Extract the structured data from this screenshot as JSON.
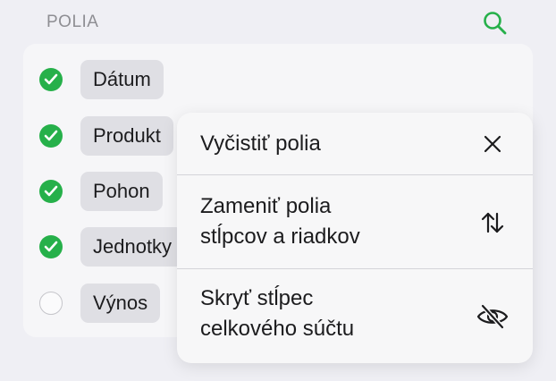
{
  "section": {
    "title": "POLIA"
  },
  "search": {
    "icon": "search-icon",
    "color": "#26b04a"
  },
  "fields": [
    {
      "label": "Dátum",
      "checked": true
    },
    {
      "label": "Produkt",
      "checked": true
    },
    {
      "label": "Pohon",
      "checked": true
    },
    {
      "label": "Jednotky",
      "checked": true
    },
    {
      "label": "Výnos",
      "checked": false
    }
  ],
  "menu": {
    "items": [
      {
        "label_lines": [
          "Vyčistiť polia"
        ],
        "icon": "close-icon"
      },
      {
        "label_lines": [
          "Zameniť polia",
          "stĺpcov a riadkov"
        ],
        "icon": "swap-arrows-icon"
      },
      {
        "label_lines": [
          "Skryť stĺpec",
          "celkového súčtu"
        ],
        "icon": "eye-slash-icon"
      }
    ]
  },
  "colors": {
    "accent": "#26b04a",
    "background": "#efeff4"
  }
}
